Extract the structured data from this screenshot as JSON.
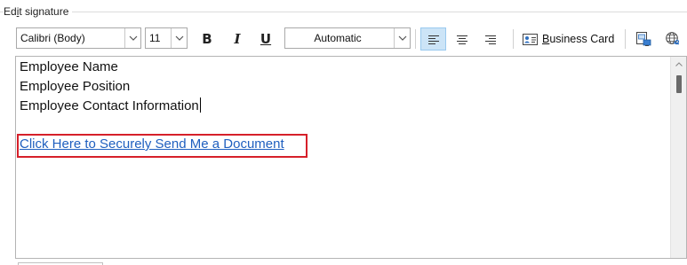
{
  "group": {
    "label_prefix": "Ed",
    "label_accel": "i",
    "label_suffix": "t signature"
  },
  "toolbar": {
    "font_family": "Calibri (Body)",
    "font_size": "11",
    "font_color": "Automatic",
    "business_card_accel": "B",
    "business_card_rest": "usiness Card"
  },
  "editor": {
    "lines": [
      "Employee Name",
      "Employee Position",
      "Employee Contact Information"
    ],
    "link_text": "Click Here to Securely Send Me a Document"
  },
  "colors": {
    "link": "#1f5fbf",
    "highlight_box": "#d6202a",
    "active_button": "#cce4f7"
  },
  "icons": {
    "bold": "bold-icon",
    "italic": "italic-icon",
    "underline": "underline-icon",
    "align_left": "align-left-icon",
    "align_center": "align-center-icon",
    "align_right": "align-right-icon",
    "business_card": "business-card-icon",
    "insert_picture": "insert-picture-icon",
    "hyperlink": "hyperlink-icon"
  }
}
